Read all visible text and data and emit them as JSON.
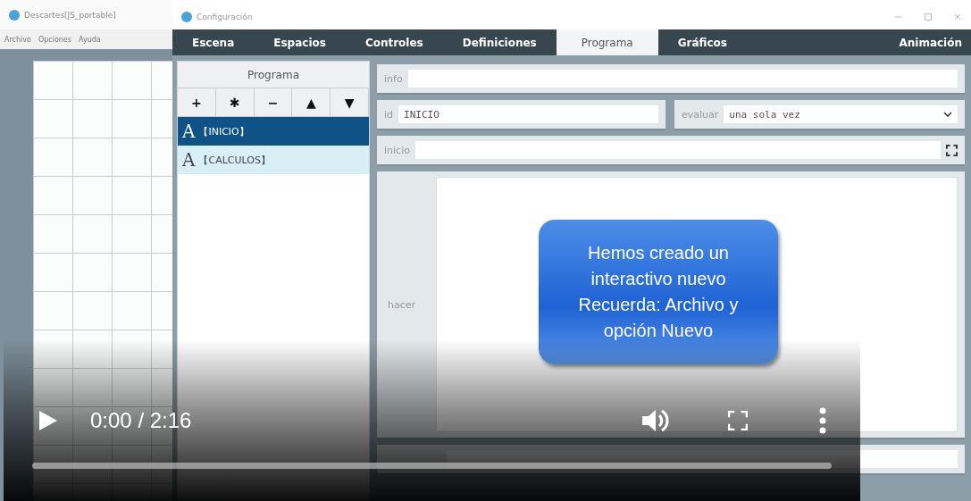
{
  "background_window": {
    "title": "Descartes[JS_portable]",
    "menu": [
      "Archivo",
      "Opciones",
      "Ayuda"
    ]
  },
  "config_window": {
    "title": "Configuración",
    "tabs": [
      {
        "label": "Escena",
        "selected": false
      },
      {
        "label": "Espacios",
        "selected": false
      },
      {
        "label": "Controles",
        "selected": false
      },
      {
        "label": "Definiciones",
        "selected": false
      },
      {
        "label": "Programa",
        "selected": true
      },
      {
        "label": "Gráficos",
        "selected": false
      },
      {
        "label": "Animación",
        "selected": false
      }
    ],
    "program_panel": {
      "header": "Programa",
      "tools": [
        "+",
        "✱",
        "−",
        "▲",
        "▼"
      ],
      "items": [
        {
          "glyph": "A",
          "label": "【INICIO】",
          "selected": true
        },
        {
          "glyph": "A",
          "label": "【CALCULOS】",
          "selected": false
        }
      ]
    },
    "form": {
      "info": {
        "label": "info"
      },
      "id": {
        "label": "id",
        "value": "INICIO"
      },
      "evaluar": {
        "label": "evaluar",
        "value": "una sola vez"
      },
      "inicio": {
        "label": "inicio"
      },
      "hacer": {
        "label": "hacer"
      }
    }
  },
  "callout": {
    "lines": [
      "Hemos creado un",
      "interactivo nuevo",
      "Recuerda: Archivo y",
      "opción Nuevo"
    ]
  },
  "video_player": {
    "time": "0:00 / 2:16",
    "progress": {
      "level": 0
    }
  }
}
